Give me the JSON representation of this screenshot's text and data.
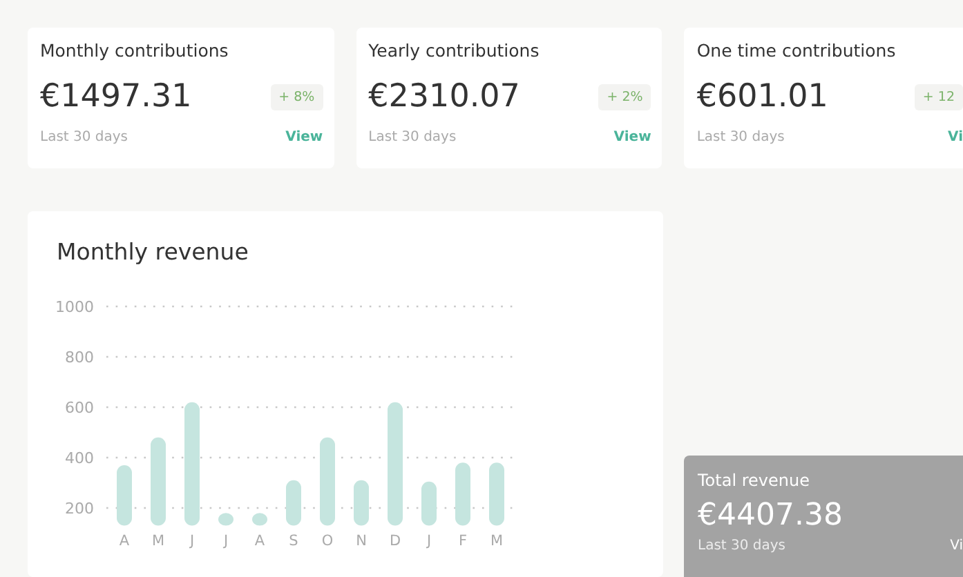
{
  "cards": [
    {
      "title": "Monthly contributions",
      "value": "€1497.31",
      "change": "+ 8%",
      "period": "Last 30 days",
      "link": "View"
    },
    {
      "title": "Yearly contributions",
      "value": "€2310.07",
      "change": "+ 2%",
      "period": "Last 30 days",
      "link": "View"
    },
    {
      "title": "One time contributions",
      "value": "€601.01",
      "change": "+ 12",
      "period": "Last 30 days",
      "link": "Vi"
    }
  ],
  "revenue_chart": {
    "title": "Monthly revenue",
    "chart_data": {
      "type": "bar",
      "categories": [
        "A",
        "M",
        "J",
        "J",
        "A",
        "S",
        "O",
        "N",
        "D",
        "J",
        "F",
        "M"
      ],
      "values": [
        370,
        480,
        620,
        180,
        180,
        310,
        480,
        310,
        620,
        305,
        380,
        380
      ],
      "ylim": [
        130,
        1000
      ],
      "yticks": [
        200,
        400,
        600,
        800,
        1000
      ],
      "grid": true
    }
  },
  "total": {
    "title": "Total revenue",
    "value": "€4407.38",
    "period": "Last 30 days",
    "link": "Vi"
  }
}
